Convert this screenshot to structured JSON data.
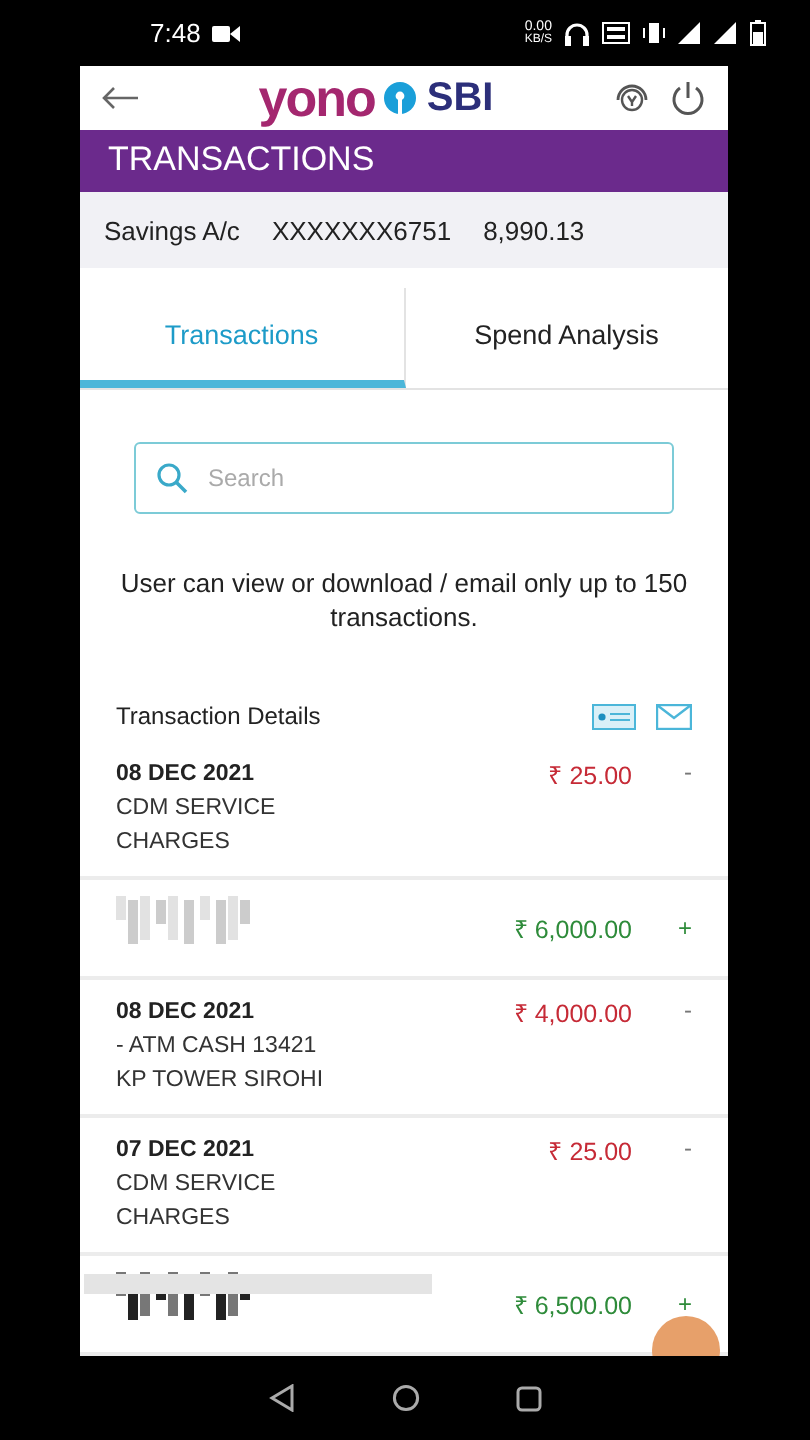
{
  "status_bar": {
    "time": "7:48",
    "net_speed": "0.00",
    "net_unit": "KB/S"
  },
  "header": {
    "brand_word": "yono",
    "brand_bank": "SBI"
  },
  "title_bar": {
    "title": "TRANSACTIONS"
  },
  "account": {
    "type": "Savings A/c",
    "number": "XXXXXXX6751",
    "balance": "8,990.13"
  },
  "tabs": [
    {
      "label": "Transactions",
      "selected": true
    },
    {
      "label": "Spend Analysis",
      "selected": false
    }
  ],
  "search": {
    "placeholder": "Search"
  },
  "notice": "User can view or download / email only up to 150 transactions.",
  "details_heading": "Transaction Details",
  "transactions": [
    {
      "redacted": false,
      "date": "08 DEC 2021",
      "description": [
        "CDM SERVICE",
        "CHARGES"
      ],
      "amount": "₹ 25.00",
      "sign": "-",
      "kind": "debit"
    },
    {
      "redacted": true,
      "amount": "₹ 6,000.00",
      "sign": "+",
      "kind": "credit"
    },
    {
      "redacted": false,
      "date": "08 DEC 2021",
      "description": [
        "- ATM CASH 13421",
        "KP TOWER SIROHI"
      ],
      "amount": "₹ 4,000.00",
      "sign": "-",
      "kind": "debit"
    },
    {
      "redacted": false,
      "date": "07 DEC 2021",
      "description": [
        "CDM SERVICE",
        "CHARGES"
      ],
      "amount": "₹ 25.00",
      "sign": "-",
      "kind": "debit"
    },
    {
      "redacted": true,
      "amount": "₹ 6,500.00",
      "sign": "+",
      "kind": "credit"
    }
  ]
}
